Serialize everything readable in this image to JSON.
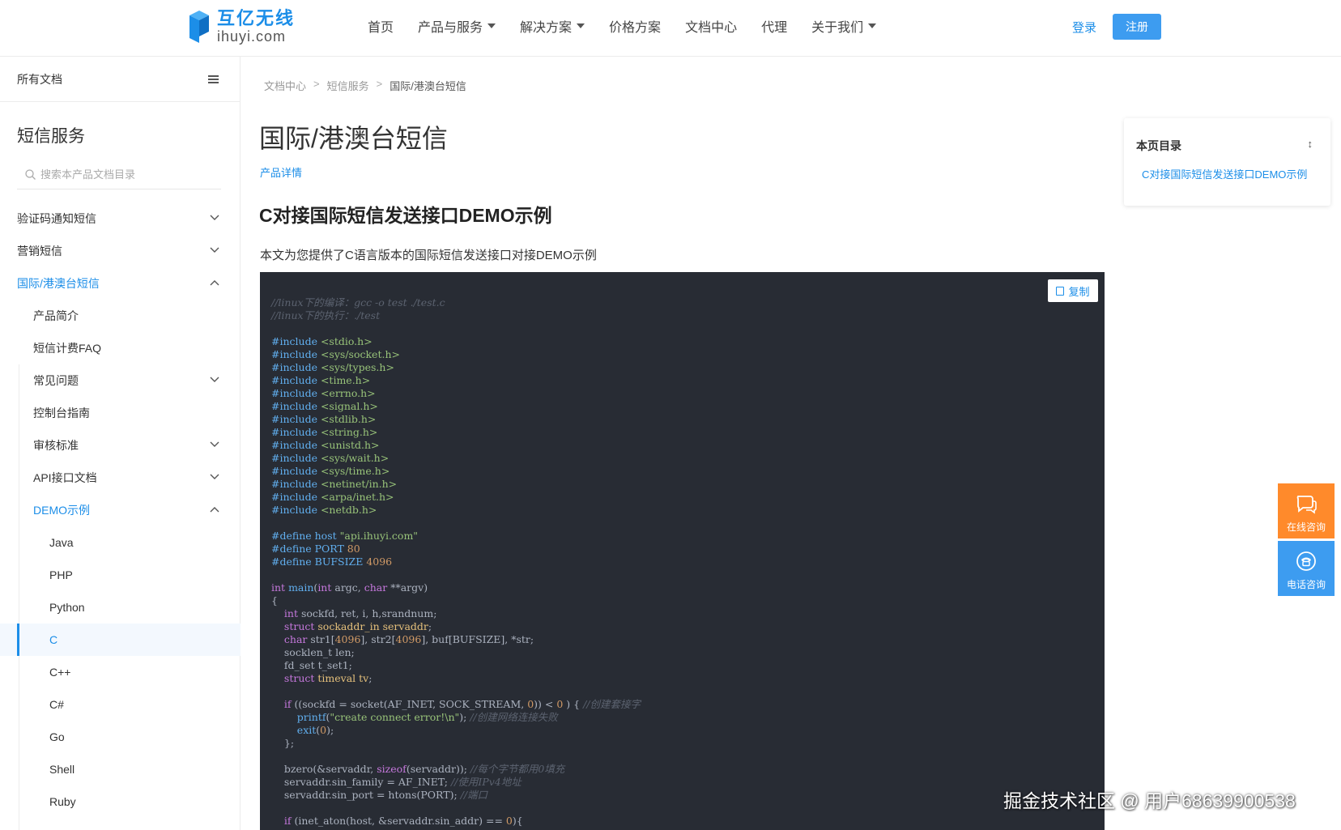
{
  "header": {
    "logo_cn": "互亿无线",
    "logo_en": "ihuyi.com",
    "nav": [
      {
        "label": "首页",
        "dropdown": false
      },
      {
        "label": "产品与服务",
        "dropdown": true
      },
      {
        "label": "解决方案",
        "dropdown": true
      },
      {
        "label": "价格方案",
        "dropdown": false
      },
      {
        "label": "文档中心",
        "dropdown": false
      },
      {
        "label": "代理",
        "dropdown": false
      },
      {
        "label": "关于我们",
        "dropdown": true
      }
    ],
    "login": "登录",
    "register": "注册"
  },
  "sidebar": {
    "all_docs": "所有文档",
    "title": "短信服务",
    "search_placeholder": "搜索本产品文档目录",
    "items": [
      {
        "label": "验证码通知短信",
        "level": 0,
        "chevron": "down",
        "state": ""
      },
      {
        "label": "营销短信",
        "level": 0,
        "chevron": "down",
        "state": ""
      },
      {
        "label": "国际/港澳台短信",
        "level": 0,
        "chevron": "up",
        "state": "active-parent"
      },
      {
        "label": "产品简介",
        "level": 1,
        "chevron": "",
        "state": ""
      },
      {
        "label": "短信计费FAQ",
        "level": 1,
        "chevron": "",
        "state": ""
      },
      {
        "label": "常见问题",
        "level": 1,
        "chevron": "down",
        "state": ""
      },
      {
        "label": "控制台指南",
        "level": 1,
        "chevron": "",
        "state": ""
      },
      {
        "label": "审核标准",
        "level": 1,
        "chevron": "down",
        "state": ""
      },
      {
        "label": "API接口文档",
        "level": 1,
        "chevron": "down",
        "state": ""
      },
      {
        "label": "DEMO示例",
        "level": 1,
        "chevron": "up",
        "state": "active-parent"
      },
      {
        "label": "Java",
        "level": 2,
        "chevron": "",
        "state": ""
      },
      {
        "label": "PHP",
        "level": 2,
        "chevron": "",
        "state": ""
      },
      {
        "label": "Python",
        "level": 2,
        "chevron": "",
        "state": ""
      },
      {
        "label": "C",
        "level": 2,
        "chevron": "",
        "state": "selected"
      },
      {
        "label": "C++",
        "level": 2,
        "chevron": "",
        "state": ""
      },
      {
        "label": "C#",
        "level": 2,
        "chevron": "",
        "state": ""
      },
      {
        "label": "Go",
        "level": 2,
        "chevron": "",
        "state": ""
      },
      {
        "label": "Shell",
        "level": 2,
        "chevron": "",
        "state": ""
      },
      {
        "label": "Ruby",
        "level": 2,
        "chevron": "",
        "state": ""
      }
    ]
  },
  "main": {
    "breadcrumb": [
      "文档中心",
      "短信服务",
      "国际/港澳台短信"
    ],
    "breadcrumb_sep": ">",
    "title": "国际/港澳台短信",
    "product_link": "产品详情",
    "section_title": "C对接国际短信发送接口DEMO示例",
    "intro": "本文为您提供了C语言版本的国际短信发送接口对接DEMO示例",
    "copy_label": "复制",
    "code_lines": [
      [
        [
          "c",
          "//linux下的编译：gcc -o test ./test.c"
        ]
      ],
      [
        [
          "c",
          "//linux下的执行：./test"
        ]
      ],
      [],
      [
        [
          "p",
          "#include "
        ],
        [
          "s",
          "<stdio.h>"
        ]
      ],
      [
        [
          "p",
          "#include "
        ],
        [
          "s",
          "<sys/socket.h>"
        ]
      ],
      [
        [
          "p",
          "#include "
        ],
        [
          "s",
          "<sys/types.h>"
        ]
      ],
      [
        [
          "p",
          "#include "
        ],
        [
          "s",
          "<time.h>"
        ]
      ],
      [
        [
          "p",
          "#include "
        ],
        [
          "s",
          "<errno.h>"
        ]
      ],
      [
        [
          "p",
          "#include "
        ],
        [
          "s",
          "<signal.h>"
        ]
      ],
      [
        [
          "p",
          "#include "
        ],
        [
          "s",
          "<stdlib.h>"
        ]
      ],
      [
        [
          "p",
          "#include "
        ],
        [
          "s",
          "<string.h>"
        ]
      ],
      [
        [
          "p",
          "#include "
        ],
        [
          "s",
          "<unistd.h>"
        ]
      ],
      [
        [
          "p",
          "#include "
        ],
        [
          "s",
          "<sys/wait.h>"
        ]
      ],
      [
        [
          "p",
          "#include "
        ],
        [
          "s",
          "<sys/time.h>"
        ]
      ],
      [
        [
          "p",
          "#include "
        ],
        [
          "s",
          "<netinet/in.h>"
        ]
      ],
      [
        [
          "p",
          "#include "
        ],
        [
          "s",
          "<arpa/inet.h>"
        ]
      ],
      [
        [
          "p",
          "#include "
        ],
        [
          "s",
          "<netdb.h>"
        ]
      ],
      [],
      [
        [
          "p",
          "#define host "
        ],
        [
          "s",
          "\"api.ihuyi.com\""
        ]
      ],
      [
        [
          "p",
          "#define PORT "
        ],
        [
          "n",
          "80"
        ]
      ],
      [
        [
          "p",
          "#define BUFSIZE "
        ],
        [
          "n",
          "4096"
        ]
      ],
      [],
      [
        [
          "k",
          "int"
        ],
        [
          "t",
          " "
        ],
        [
          "f",
          "main"
        ],
        [
          "t",
          "("
        ],
        [
          "k",
          "int"
        ],
        [
          "t",
          " argc, "
        ],
        [
          "k",
          "char"
        ],
        [
          "t",
          " **argv)"
        ]
      ],
      [
        [
          "t",
          "{"
        ]
      ],
      [
        [
          "t",
          "    "
        ],
        [
          "k",
          "int"
        ],
        [
          "t",
          " sockfd, ret, i, h,srandnum;"
        ]
      ],
      [
        [
          "t",
          "    "
        ],
        [
          "k",
          "struct"
        ],
        [
          "t",
          " "
        ],
        [
          "y",
          "sockaddr_in servaddr"
        ],
        [
          "t",
          ";"
        ]
      ],
      [
        [
          "t",
          "    "
        ],
        [
          "k",
          "char"
        ],
        [
          "t",
          " str1["
        ],
        [
          "n",
          "4096"
        ],
        [
          "t",
          "], str2["
        ],
        [
          "n",
          "4096"
        ],
        [
          "t",
          "], buf[BUFSIZE], *str;"
        ]
      ],
      [
        [
          "t",
          "    socklen_t len;"
        ]
      ],
      [
        [
          "t",
          "    fd_set t_set1;"
        ]
      ],
      [
        [
          "t",
          "    "
        ],
        [
          "k",
          "struct"
        ],
        [
          "t",
          " "
        ],
        [
          "y",
          "timeval tv"
        ],
        [
          "t",
          ";"
        ]
      ],
      [],
      [
        [
          "t",
          "    "
        ],
        [
          "k",
          "if"
        ],
        [
          "t",
          " ((sockfd = socket(AF_INET, SOCK_STREAM, "
        ],
        [
          "n",
          "0"
        ],
        [
          "t",
          ")) < "
        ],
        [
          "n",
          "0"
        ],
        [
          "t",
          " ) { "
        ],
        [
          "c",
          "//创建套接字"
        ]
      ],
      [
        [
          "t",
          "        "
        ],
        [
          "f",
          "printf"
        ],
        [
          "t",
          "("
        ],
        [
          "s",
          "\"create connect error!\\n\""
        ],
        [
          "t",
          "); "
        ],
        [
          "c",
          "//创建网络连接失败"
        ]
      ],
      [
        [
          "t",
          "        "
        ],
        [
          "f",
          "exit"
        ],
        [
          "t",
          "("
        ],
        [
          "n",
          "0"
        ],
        [
          "t",
          ");"
        ]
      ],
      [
        [
          "t",
          "    };"
        ]
      ],
      [],
      [
        [
          "t",
          "    bzero(&servaddr, "
        ],
        [
          "k",
          "sizeof"
        ],
        [
          "t",
          "(servaddr)); "
        ],
        [
          "c",
          "//每个字节都用0填充"
        ]
      ],
      [
        [
          "t",
          "    servaddr.sin_family = AF_INET; "
        ],
        [
          "c",
          "//使用IPv4地址"
        ]
      ],
      [
        [
          "t",
          "    servaddr.sin_port = htons(PORT); "
        ],
        [
          "c",
          "//端口"
        ]
      ],
      [],
      [
        [
          "t",
          "    "
        ],
        [
          "k",
          "if"
        ],
        [
          "t",
          " (inet_aton(host, &servaddr.sin_addr) == "
        ],
        [
          "n",
          "0"
        ],
        [
          "t",
          "){"
        ]
      ]
    ]
  },
  "toc": {
    "title": "本页目录",
    "toggle": "↕",
    "link": "C对接国际短信发送接口DEMO示例"
  },
  "float": {
    "online": "在线咨询",
    "phone": "电话咨询"
  },
  "watermark": "掘金技术社区 @ 用户68639900538",
  "colors": {
    "accent": "#1c8ee8",
    "register_bg": "#3d9cf0",
    "code_bg": "#282c34",
    "float_orange": "#ff8a2b"
  }
}
